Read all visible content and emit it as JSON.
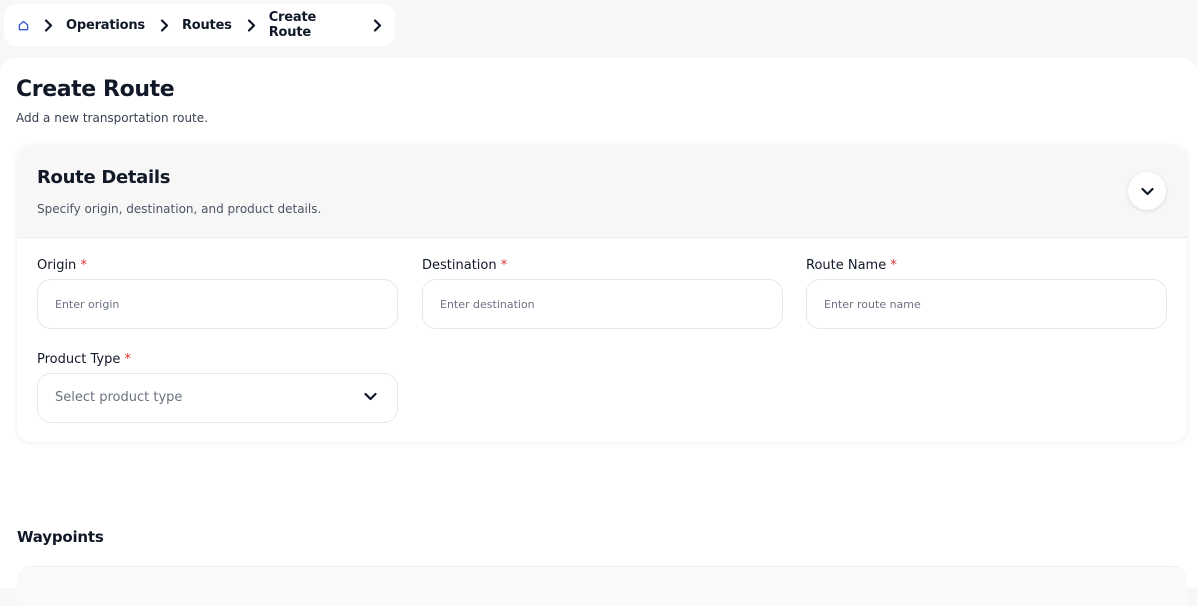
{
  "breadcrumb": {
    "items": [
      "Operations",
      "Routes",
      "Create Route"
    ]
  },
  "page": {
    "title": "Create Route",
    "subtitle": "Add a new transportation route."
  },
  "route_details": {
    "title": "Route Details",
    "subtitle": "Specify origin, destination, and product details.",
    "fields": {
      "origin": {
        "label": "Origin",
        "required_mark": "*",
        "placeholder": "Enter origin",
        "value": ""
      },
      "destination": {
        "label": "Destination",
        "required_mark": "*",
        "placeholder": "Enter destination",
        "value": ""
      },
      "route_name": {
        "label": "Route Name",
        "required_mark": "*",
        "placeholder": "Enter route name",
        "value": ""
      },
      "product_type": {
        "label": "Product Type",
        "required_mark": "*",
        "placeholder": "Select product type"
      }
    }
  },
  "waypoints": {
    "title": "Waypoints"
  },
  "colors": {
    "accent": "#3b5bdb",
    "required": "#e03131",
    "page_bg": "#f7f7f8"
  },
  "icons": {
    "home": "home-icon",
    "separator": "chevron-right-icon",
    "collapse": "chevron-down-icon",
    "select": "chevron-down-icon"
  }
}
